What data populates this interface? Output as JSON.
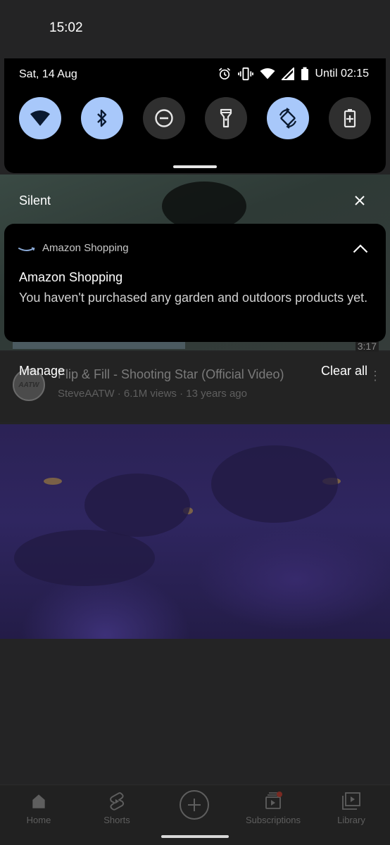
{
  "status_bar": {
    "time": "15:02"
  },
  "quick_settings": {
    "date": "Sat, 14 Aug",
    "battery_text": "Until 02:15",
    "status_icons": [
      "alarm-icon",
      "vibrate-icon",
      "wifi-signal-icon",
      "cell-signal-icon",
      "battery-icon"
    ],
    "tiles": [
      {
        "icon": "wifi-icon",
        "active": true
      },
      {
        "icon": "bluetooth-icon",
        "active": true
      },
      {
        "icon": "do-not-disturb-icon",
        "active": false
      },
      {
        "icon": "flashlight-icon",
        "active": false
      },
      {
        "icon": "auto-rotate-icon",
        "active": true
      },
      {
        "icon": "battery-saver-icon",
        "active": false
      }
    ]
  },
  "notifications": {
    "section_label": "Silent",
    "card": {
      "app_name": "Amazon Shopping",
      "title": "Amazon Shopping",
      "text": "You haven't purchased any garden and outdoors products yet."
    },
    "manage_label": "Manage",
    "clear_all_label": "Clear all"
  },
  "background_app": {
    "video_duration": "3:17",
    "video_title": "Flip & Fill - Shooting Star (Official Video)",
    "video_meta": "SteveAATW · 6.1M views · 13 years ago",
    "channel_avatar_text": "AATW",
    "nav": {
      "home": "Home",
      "shorts": "Shorts",
      "subscriptions": "Subscriptions",
      "library": "Library"
    }
  },
  "colors": {
    "tile_active": "#a8c8fa",
    "tile_inactive": "#2f2f2f",
    "panel": "#000000"
  }
}
